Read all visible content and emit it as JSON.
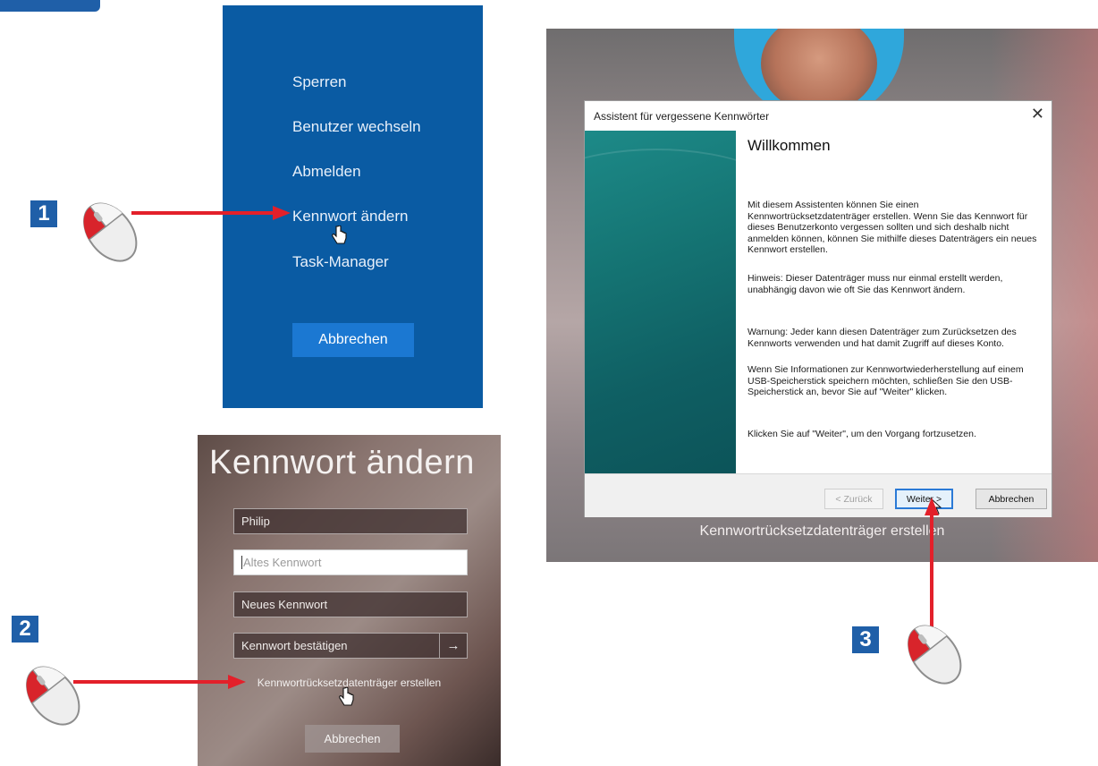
{
  "panel1": {
    "menu": [
      "Sperren",
      "Benutzer wechseln",
      "Abmelden",
      "Kennwort ändern",
      "Task-Manager"
    ],
    "cancel_label": "Abbrechen"
  },
  "panel2": {
    "title": "Kennwort ändern",
    "username_value": "Philip",
    "old_password_placeholder": "Altes Kennwort",
    "new_password_placeholder": "Neues Kennwort",
    "confirm_password_placeholder": "Kennwort bestätigen",
    "submit_icon": "→",
    "reset_disk_link": "Kennwortrücksetzdatenträger erstellen",
    "cancel_label": "Abbrechen"
  },
  "panel3": {
    "caption": "Kennwortrücksetzdatenträger erstellen",
    "wizard": {
      "window_title": "Assistent für vergessene Kennwörter",
      "close_glyph": "✕",
      "heading": "Willkommen",
      "paragraphs": [
        "Mit diesem Assistenten können Sie einen Kennwortrücksetzdatenträger erstellen. Wenn Sie das Kennwort für dieses Benutzerkonto vergessen sollten und sich deshalb nicht anmelden können, können Sie mithilfe dieses Datenträgers ein neues Kennwort erstellen.",
        "Hinweis: Dieser Datenträger muss nur einmal erstellt werden, unabhängig davon wie oft Sie das Kennwort ändern.",
        "Warnung: Jeder kann diesen Datenträger zum Zurücksetzen des Kennworts verwenden und hat damit Zugriff auf dieses Konto.",
        "Wenn Sie Informationen zur Kennwortwiederherstellung auf einem USB-Speicherstick speichern möchten, schließen Sie den USB-Speicherstick an, bevor Sie auf \"Weiter\" klicken.",
        "Klicken Sie auf \"Weiter\", um den Vorgang fortzusetzen."
      ],
      "back_label": "< Zurück",
      "next_label": "Weiter >",
      "cancel_label": "Abbrechen"
    }
  },
  "steps": [
    "1",
    "2",
    "3"
  ],
  "colors": {
    "accent_blue": "#0a5ba3",
    "badge_blue": "#1f5fa8",
    "arrow_red": "#e3202a",
    "wizard_teal": "#157574"
  },
  "icons": [
    "mouse-icon",
    "hand-cursor-icon",
    "close-icon",
    "arrow-right-icon"
  ]
}
